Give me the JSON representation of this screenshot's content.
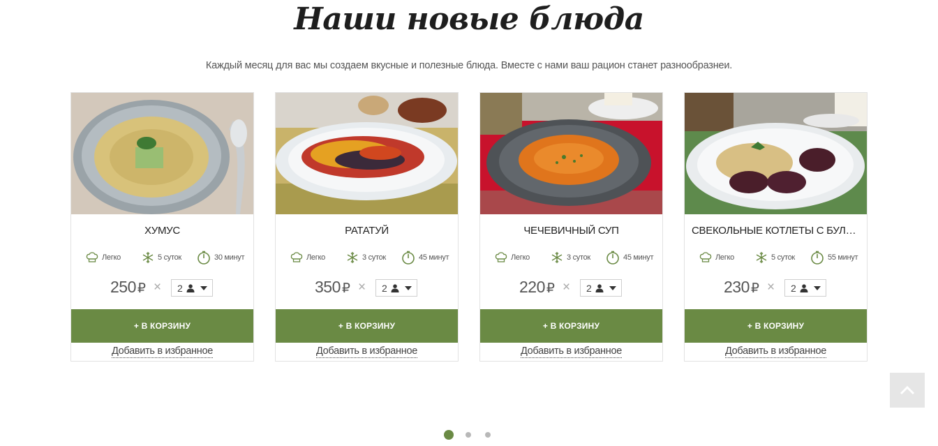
{
  "section": {
    "title": "Наши новые блюда",
    "subtitle": "Каждый месяц для вас мы создаем вкусные и полезные блюда. Вместе с нами ваш рацион станет разнообразнеи."
  },
  "colors": {
    "accent": "#6a8a44",
    "text": "#333333",
    "card_border": "#e2e2e2"
  },
  "icons": {
    "difficulty": "chef-hat-icon",
    "storage": "snowflake-icon",
    "time": "timer-icon",
    "person": "person-icon",
    "dropdown": "caret-down-icon",
    "scroll_top": "chevron-up-icon"
  },
  "dishes": [
    {
      "name": "ХУМУС",
      "difficulty": "Легко",
      "storage": "5 суток",
      "time": "30 минут",
      "price": "250",
      "currency": "₽",
      "times": "×",
      "portions": "2",
      "cart_label": "+ В КОРЗИНУ",
      "favorite_label": "Добавить в избранное"
    },
    {
      "name": "РАТАТУЙ",
      "difficulty": "Легко",
      "storage": "3 суток",
      "time": "45 минут",
      "price": "350",
      "currency": "₽",
      "times": "×",
      "portions": "2",
      "cart_label": "+ В КОРЗИНУ",
      "favorite_label": "Добавить в избранное"
    },
    {
      "name": "ЧЕЧЕВИЧНЫЙ СУП",
      "difficulty": "Легко",
      "storage": "3 суток",
      "time": "45 минут",
      "price": "220",
      "currency": "₽",
      "times": "×",
      "portions": "2",
      "cart_label": "+ В КОРЗИНУ",
      "favorite_label": "Добавить в избранное"
    },
    {
      "name": "СВЕКОЛЬНЫЕ КОТЛЕТЫ С БУЛГУРОМ...",
      "difficulty": "Легко",
      "storage": "5 суток",
      "time": "55 минут",
      "price": "230",
      "currency": "₽",
      "times": "×",
      "portions": "2",
      "cart_label": "+ В КОРЗИНУ",
      "favorite_label": "Добавить в избранное"
    }
  ],
  "carousel": {
    "page_count": 3,
    "active_page": 1
  }
}
